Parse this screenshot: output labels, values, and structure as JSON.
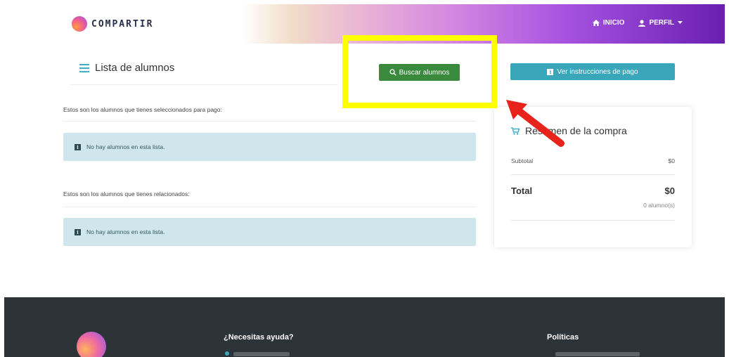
{
  "header": {
    "brand": "COMPARTIR",
    "nav": {
      "home_label": "INICIO",
      "profile_label": "PERFIL"
    }
  },
  "main": {
    "title": "Lista de alumnos",
    "search_button_label": "Buscar alumnos",
    "selected_caption": "Estos son los alumnos que tienes seleccionados para pago:",
    "selected_empty": "No hay alumnos en esta lista.",
    "related_caption": "Estos son los alumnos que tienes relacionados:",
    "related_empty": "No hay alumnos en esta lista."
  },
  "sidebar": {
    "instructions_button_label": "Ver instrucciones de pago",
    "summary": {
      "title": "Resumen de la compra",
      "subtotal_label": "Subtotal",
      "subtotal_value": "$0",
      "total_label": "Total",
      "total_value": "$0",
      "count_label": "0 alumno(s)"
    }
  },
  "footer": {
    "help_heading": "¿Necesitas ayuda?",
    "policies_heading": "Políticas"
  },
  "colors": {
    "accent_green": "#3a8a3d",
    "accent_teal": "#39a6ba",
    "highlight_yellow": "#ffff00",
    "arrow_red": "#e8231c",
    "footer_bg": "#2c3438"
  },
  "icons": [
    "home-icon",
    "user-icon",
    "caret-down-icon",
    "list-icon",
    "search-icon",
    "info-icon",
    "cart-icon"
  ]
}
